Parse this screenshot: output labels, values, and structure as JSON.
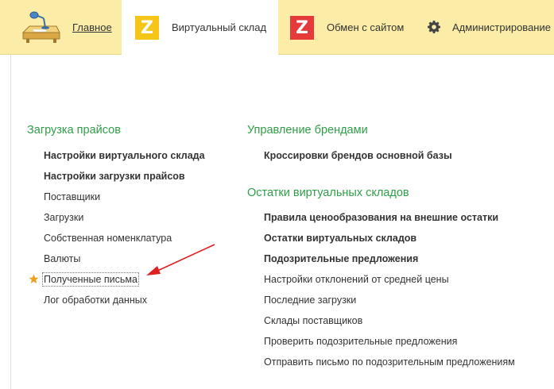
{
  "tabs": {
    "home": {
      "label": "Главное",
      "icon": "desk-lamp-icon"
    },
    "warehouse": {
      "label": "Виртуальный склад",
      "icon": "z-logo-icon",
      "icon_letter": "Z",
      "icon_color": "#f5c518"
    },
    "exchange": {
      "label": "Обмен с сайтом",
      "icon": "z-logo-icon",
      "icon_letter": "Z",
      "icon_color": "#e63939"
    },
    "admin": {
      "label": "Администрирование",
      "icon": "gear-icon"
    }
  },
  "colors": {
    "tabbar_bg": "#fbeda7",
    "section_title": "#2e9e47",
    "star": "#f0a020",
    "arrow": "#e02020"
  },
  "left": {
    "section_title": "Загрузка прайсов",
    "items": [
      {
        "label": "Настройки виртуального склада",
        "bold": true
      },
      {
        "label": "Настройки загрузки прайсов",
        "bold": true
      },
      {
        "label": "Поставщики",
        "bold": false
      },
      {
        "label": "Загрузки",
        "bold": false
      },
      {
        "label": "Собственная номенклатура",
        "bold": false
      },
      {
        "label": "Валюты",
        "bold": false
      },
      {
        "label": "Полученные письма",
        "bold": false,
        "favorite": true,
        "selected": true
      },
      {
        "label": "Лог обработки данных",
        "bold": false
      }
    ]
  },
  "right": {
    "brands": {
      "section_title": "Управление брендами",
      "items": [
        {
          "label": "Кроссировки брендов основной базы",
          "bold": true
        }
      ]
    },
    "stock": {
      "section_title": "Остатки виртуальных складов",
      "items": [
        {
          "label": "Правила ценообразования на внешние остатки",
          "bold": true
        },
        {
          "label": "Остатки виртуальных складов",
          "bold": true
        },
        {
          "label": "Подозрительные предложения",
          "bold": true
        },
        {
          "label": "Настройки отклонений от средней цены",
          "bold": false
        },
        {
          "label": "Последние загрузки",
          "bold": false
        },
        {
          "label": "Склады поставщиков",
          "bold": false
        },
        {
          "label": "Проверить подозрительные предложения",
          "bold": false
        },
        {
          "label": "Отправить письмо по подозрительным предложениям",
          "bold": false
        }
      ]
    }
  }
}
